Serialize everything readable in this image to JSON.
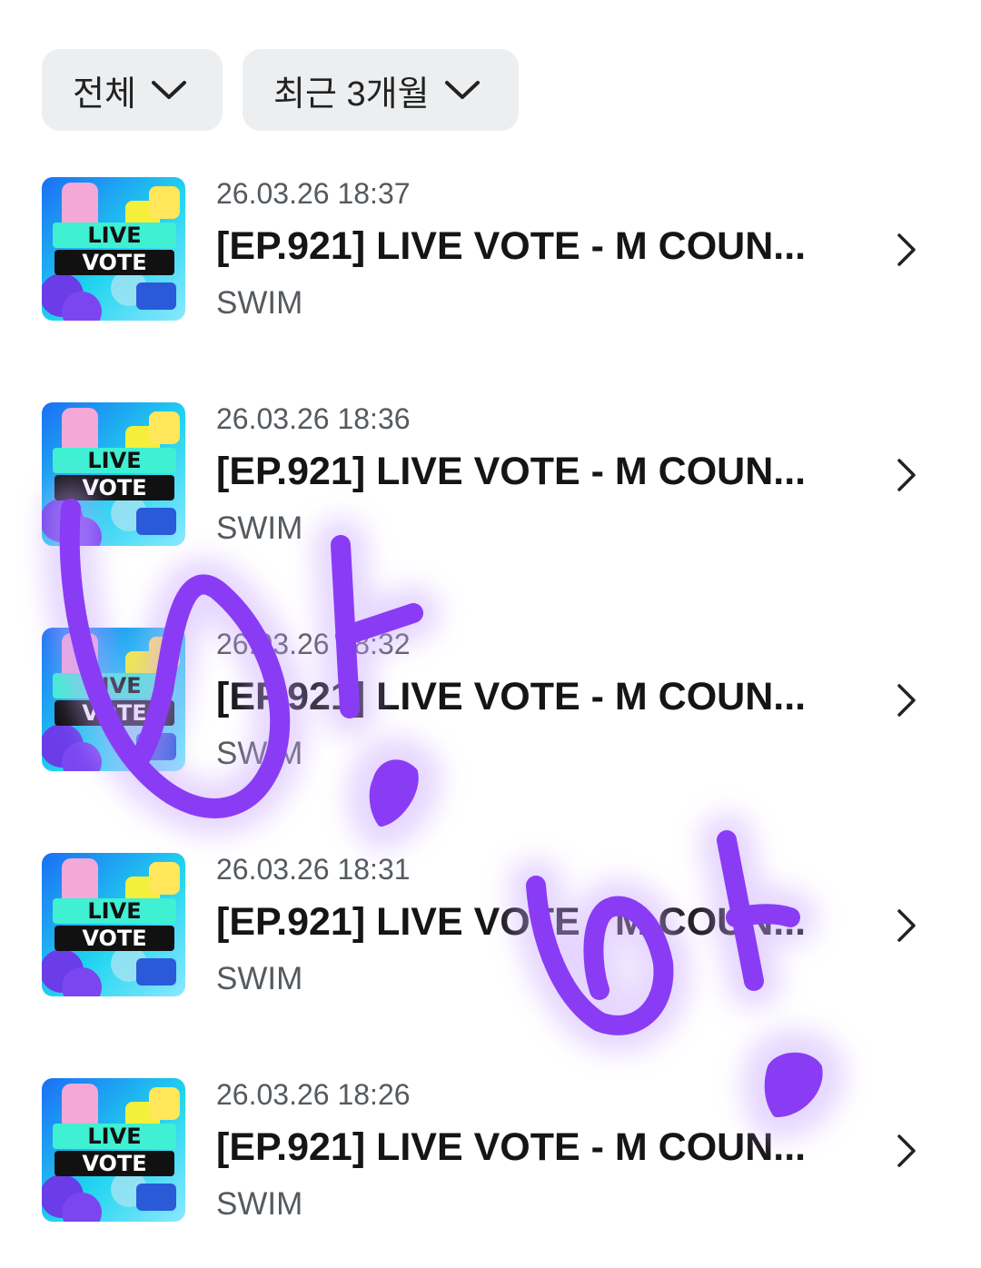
{
  "filters": {
    "category_label": "전체",
    "period_label": "최근 3개월"
  },
  "items": [
    {
      "date": "26.03.26 18:37",
      "title": "[EP.921] LIVE VOTE - M COUN...",
      "artist": "SWIM",
      "thumb_text": [
        "LIVE",
        "VOTE"
      ]
    },
    {
      "date": "26.03.26 18:36",
      "title": "[EP.921] LIVE VOTE - M COUN...",
      "artist": "SWIM",
      "thumb_text": [
        "LIVE",
        "VOTE"
      ]
    },
    {
      "date": "26.03.26 18:32",
      "title": "[EP.921] LIVE VOTE - M COUN...",
      "artist": "SWIM",
      "thumb_text": [
        "LIVE",
        "VOTE"
      ]
    },
    {
      "date": "26.03.26 18:31",
      "title": "[EP.921] LIVE VOTE - M COUN...",
      "artist": "SWIM",
      "thumb_text": [
        "LIVE",
        "VOTE"
      ]
    },
    {
      "date": "26.03.26 18:26",
      "title": "[EP.921] LIVE VOTE - M COUN...",
      "artist": "SWIM",
      "thumb_text": [
        "LIVE",
        "VOTE"
      ]
    }
  ],
  "icons": {
    "dropdown": "chevron-down-icon",
    "row_arrow": "chevron-right-icon"
  },
  "colors": {
    "chip_bg": "#eceef0",
    "doodle": "#8a3cf5"
  }
}
